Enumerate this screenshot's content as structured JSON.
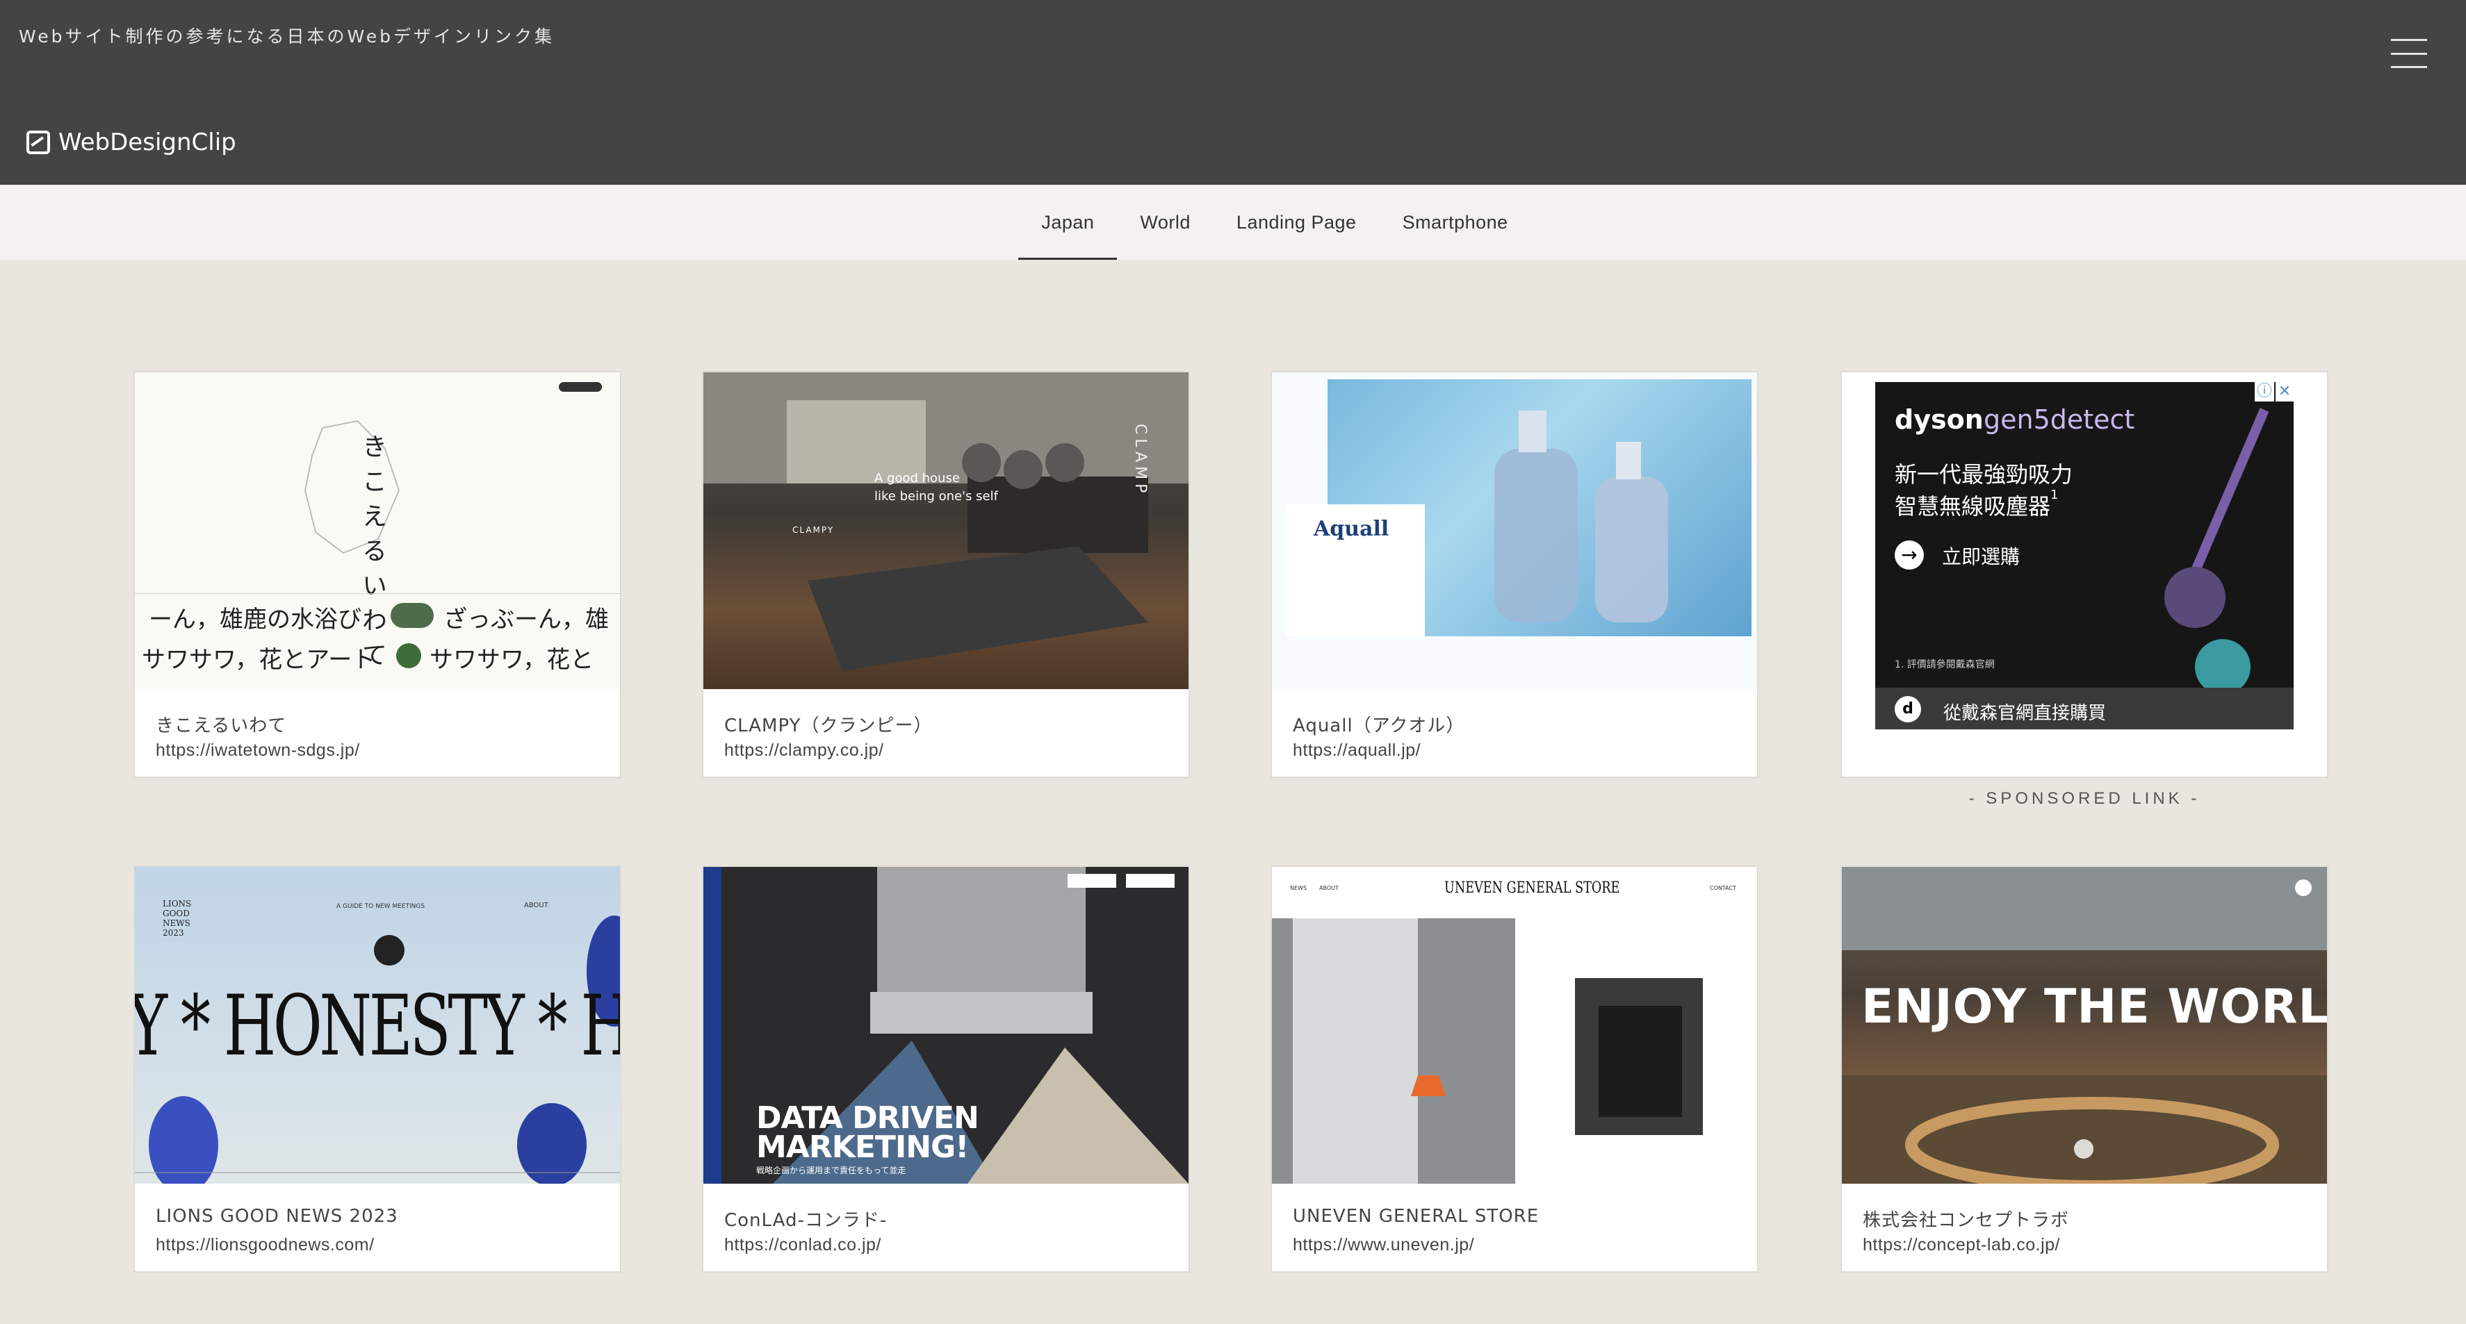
{
  "header": {
    "tagline": "Webサイト制作の参考になる日本のWebデザインリンク集",
    "logo_text": "WebDesignClip"
  },
  "nav": {
    "tabs": [
      {
        "label": "Japan",
        "active": true
      },
      {
        "label": "World",
        "active": false
      },
      {
        "label": "Landing Page",
        "active": false
      },
      {
        "label": "Smartphone",
        "active": false
      }
    ]
  },
  "cards": [
    {
      "title": "きこえるいわて",
      "url": "https://iwatetown-sdgs.jp/",
      "thumb_text": [
        "きこえるいわて",
        "ーん，雄鹿の水浴び",
        "ざっぶーん，雄",
        "サワサワ，花とアート",
        "サワサワ，花と"
      ]
    },
    {
      "title": "CLAMPY（クランピー）",
      "url": "https://clampy.co.jp/",
      "thumb_text": [
        "A good house",
        "like being one's self",
        "CLAMPY",
        "CLAMP"
      ]
    },
    {
      "title": "Aquall（アクオル）",
      "url": "https://aquall.jp/",
      "thumb_text": [
        "Aquall"
      ]
    },
    {
      "title": "LIONS GOOD NEWS 2023",
      "url": "https://lionsgoodnews.com/",
      "thumb_text": [
        "Y * HONESTY * H",
        "LIONS GOOD NEWS 2023",
        "A GUIDE TO NEW MEETINGS",
        "ABOUT"
      ]
    },
    {
      "title": "ConLAd-コンラド-",
      "url": "https://conlad.co.jp/",
      "thumb_text": [
        "DATA DRIVEN",
        "MARKETING!",
        "戦略企画から運用まで責任をもって並走"
      ]
    },
    {
      "title": "UNEVEN GENERAL STORE",
      "url": "https://www.uneven.jp/",
      "thumb_text": [
        "UNEVEN GENERAL STORE",
        "NEWS",
        "ABOUT",
        "CONTACT"
      ]
    },
    {
      "title": "株式会社コンセプトラボ",
      "url": "https://concept-lab.co.jp/",
      "thumb_text": [
        "ENJOY THE WORLD"
      ]
    }
  ],
  "ad": {
    "brand": "dyson",
    "product": "gen5detect",
    "headline_1": "新一代最強勁吸力",
    "headline_2": "智慧無線吸塵器",
    "footnote_mark": "1",
    "cta": "立即選購",
    "footnote": "1. 評價請參閱戴森官網",
    "bottom_cta": "從戴森官網直接購買",
    "label": "- SPONSORED LINK -"
  },
  "colors": {
    "header_bg": "#444444",
    "nav_bg": "#f3f2ee",
    "page_bg": "#e9e6e0"
  }
}
